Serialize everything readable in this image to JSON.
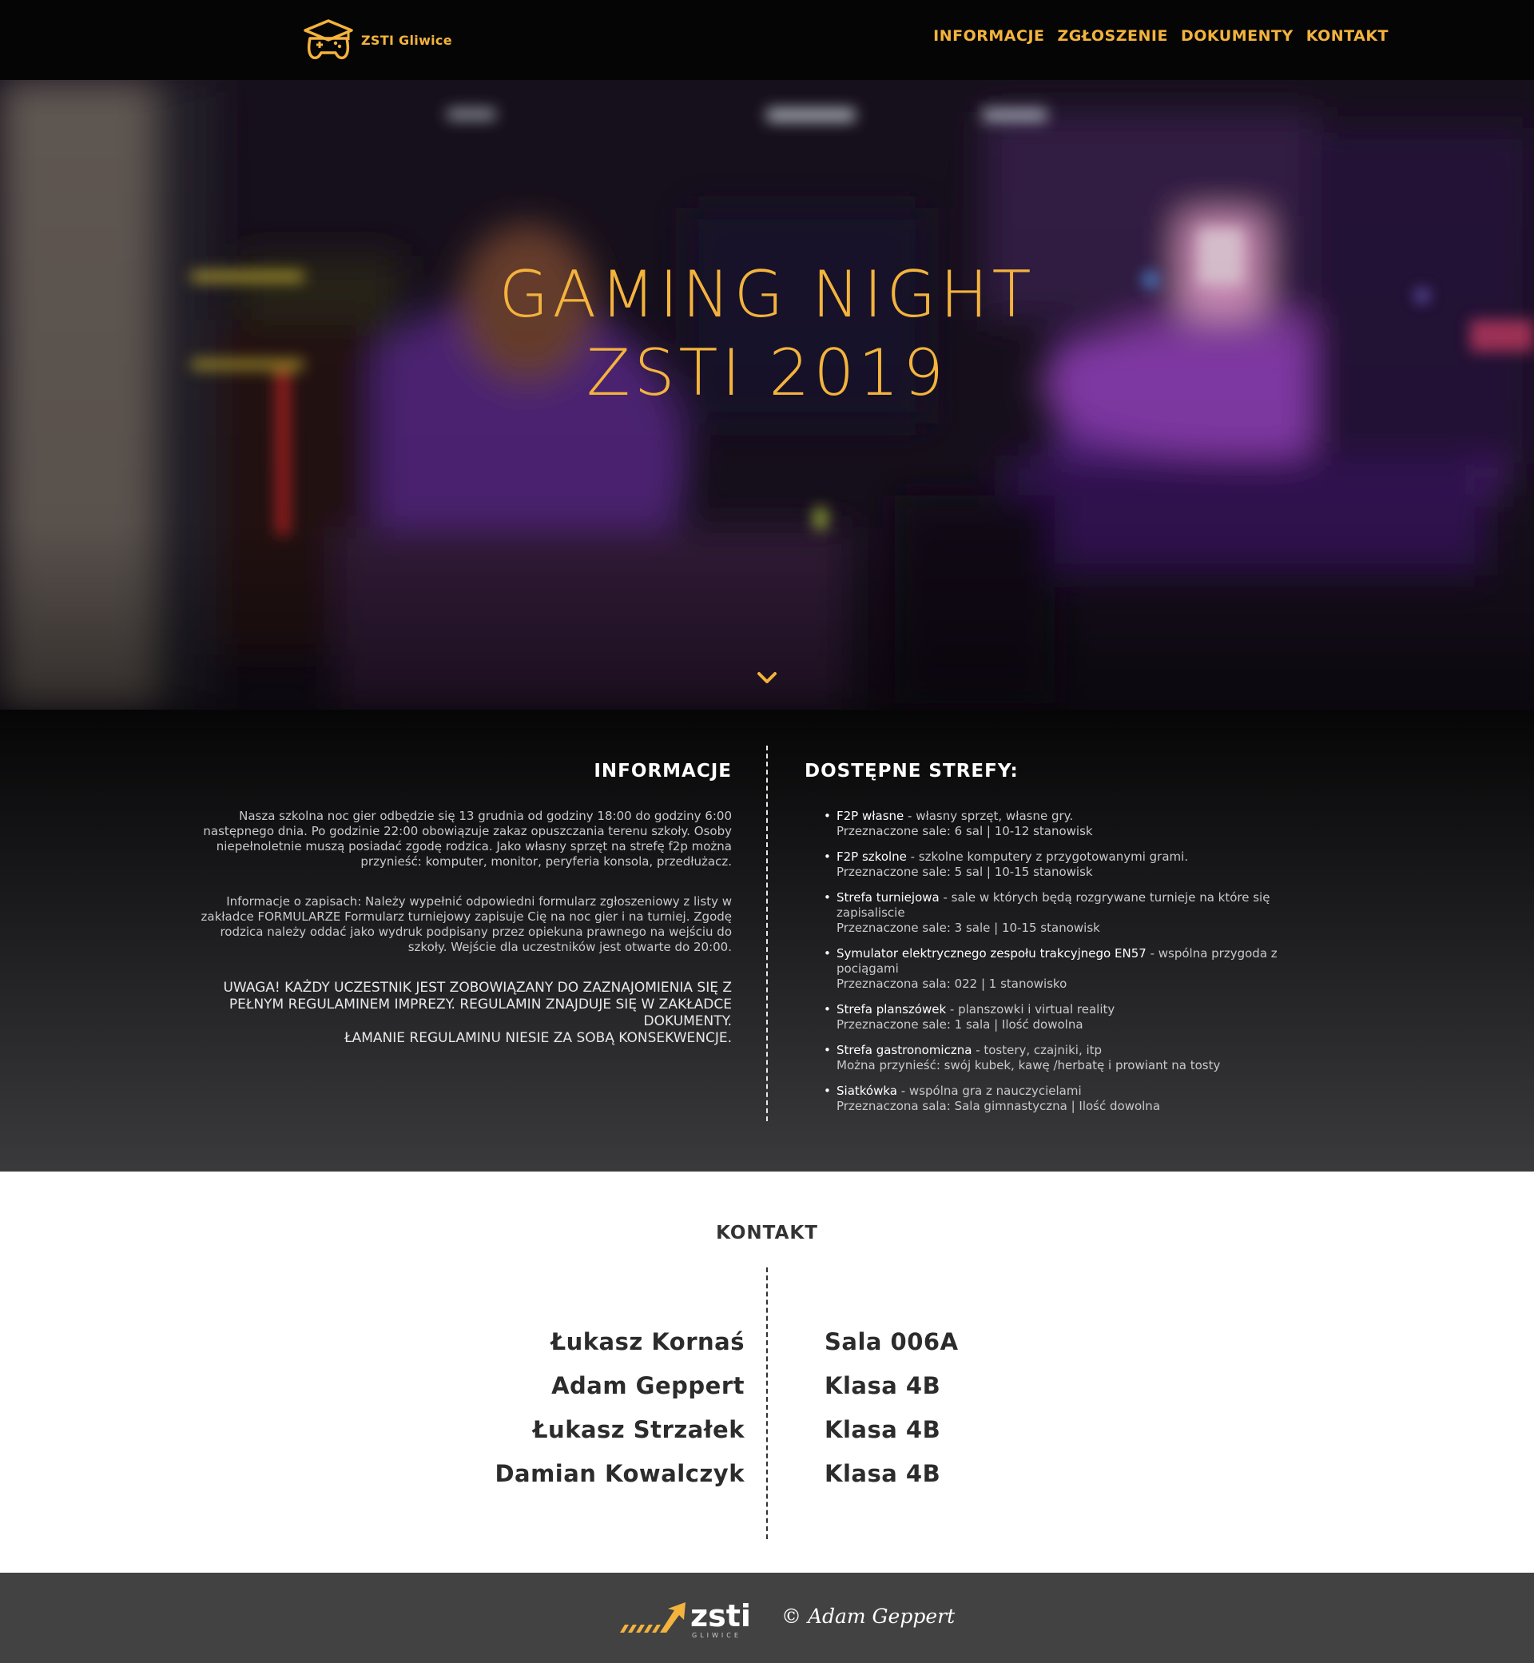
{
  "nav": {
    "logo_text": "ZSTI Gliwice",
    "items": [
      "INFORMACJE",
      "ZGŁOSZENIE",
      "DOKUMENTY",
      "KONTAKT"
    ]
  },
  "hero": {
    "title_line1": "GAMING NIGHT",
    "title_line2": "ZSTI 2019"
  },
  "info": {
    "heading": "INFORMACJE",
    "paragraph1": "Nasza szkolna noc gier odbędzie się 13 grudnia od godziny 18:00 do godziny 6:00 następnego dnia. Po godzinie 22:00 obowiązuje zakaz opuszczania terenu szkoły. Osoby niepełnoletnie muszą posiadać zgodę rodzica. Jako własny sprzęt na strefę f2p można przynieść: komputer, monitor, peryferia konsola, przedłużacz.",
    "paragraph2": "Informacje o zapisach: Należy wypełnić odpowiedni formularz zgłoszeniowy z listy w zakładce FORMULARZE Formularz turniejowy zapisuje Cię na noc gier i na turniej. Zgodę rodzica należy oddać jako wydruk podpisany przez opiekuna prawnego na wejściu do szkoły. Wejście dla uczestników jest otwarte do 20:00.",
    "warning1": "UWAGA! KAŻDY UCZESTNIK JEST ZOBOWIĄZANY DO ZAZNAJOMIENIA SIĘ Z PEŁNYM REGULAMINEM IMPREZY. REGULAMIN ZNAJDUJE SIĘ W ZAKŁADCE DOKUMENTY.",
    "warning2": "ŁAMANIE REGULAMINU NIESIE ZA SOBĄ KONSEKWENCJE."
  },
  "zones": {
    "heading": "DOSTĘPNE STREFY:",
    "items": [
      {
        "name": "F2P własne",
        "desc": " - własny sprzęt, własne gry.",
        "sub": "Przeznaczone sale: 6 sal | 10-12 stanowisk"
      },
      {
        "name": "F2P szkolne",
        "desc": " - szkolne komputery z przygotowanymi grami.",
        "sub": "Przeznaczone sale: 5 sal | 10-15 stanowisk"
      },
      {
        "name": "Strefa turniejowa",
        "desc": " - sale w których będą rozgrywane turnieje na które się zapisaliscie",
        "sub": "Przeznaczone sale: 3 sale | 10-15 stanowisk"
      },
      {
        "name": "Symulator elektrycznego zespołu trakcyjnego EN57",
        "desc": " - wspólna przygoda z pociągami",
        "sub": "Przeznaczona sala: 022 | 1 stanowisko"
      },
      {
        "name": "Strefa planszówek",
        "desc": " - planszowki i virtual reality",
        "sub": "Przeznaczone sale: 1 sala | Ilość dowolna"
      },
      {
        "name": "Strefa gastronomiczna",
        "desc": " - tostery, czajniki, itp",
        "sub": "Można przynieść: swój kubek, kawę /herbatę i prowiant na tosty"
      },
      {
        "name": "Siatkówka",
        "desc": " - wspólna gra z nauczycielami",
        "sub": "Przeznaczona sala: Sala gimnastyczna | Ilość dowolna"
      }
    ]
  },
  "contact": {
    "heading": "KONTAKT",
    "names": [
      "Łukasz Kornaś",
      "Adam Geppert",
      "Łukasz Strzałek",
      "Damian Kowalczyk"
    ],
    "rooms": [
      "Sala 006A",
      "Klasa 4B",
      "Klasa 4B",
      "Klasa 4B"
    ]
  },
  "footer": {
    "logo_text": "zsti",
    "logo_subtext": "GLIWICE",
    "copyright": "© Adam Geppert"
  },
  "colors": {
    "accent": "#f3b33d",
    "nav_bg": "#050506",
    "footer_bg": "#424243",
    "contact_text": "#2c2c2c"
  },
  "icons": [
    "graduation-gamepad-logo-icon",
    "chevron-down-icon",
    "zsti-arrow-logo-icon"
  ]
}
